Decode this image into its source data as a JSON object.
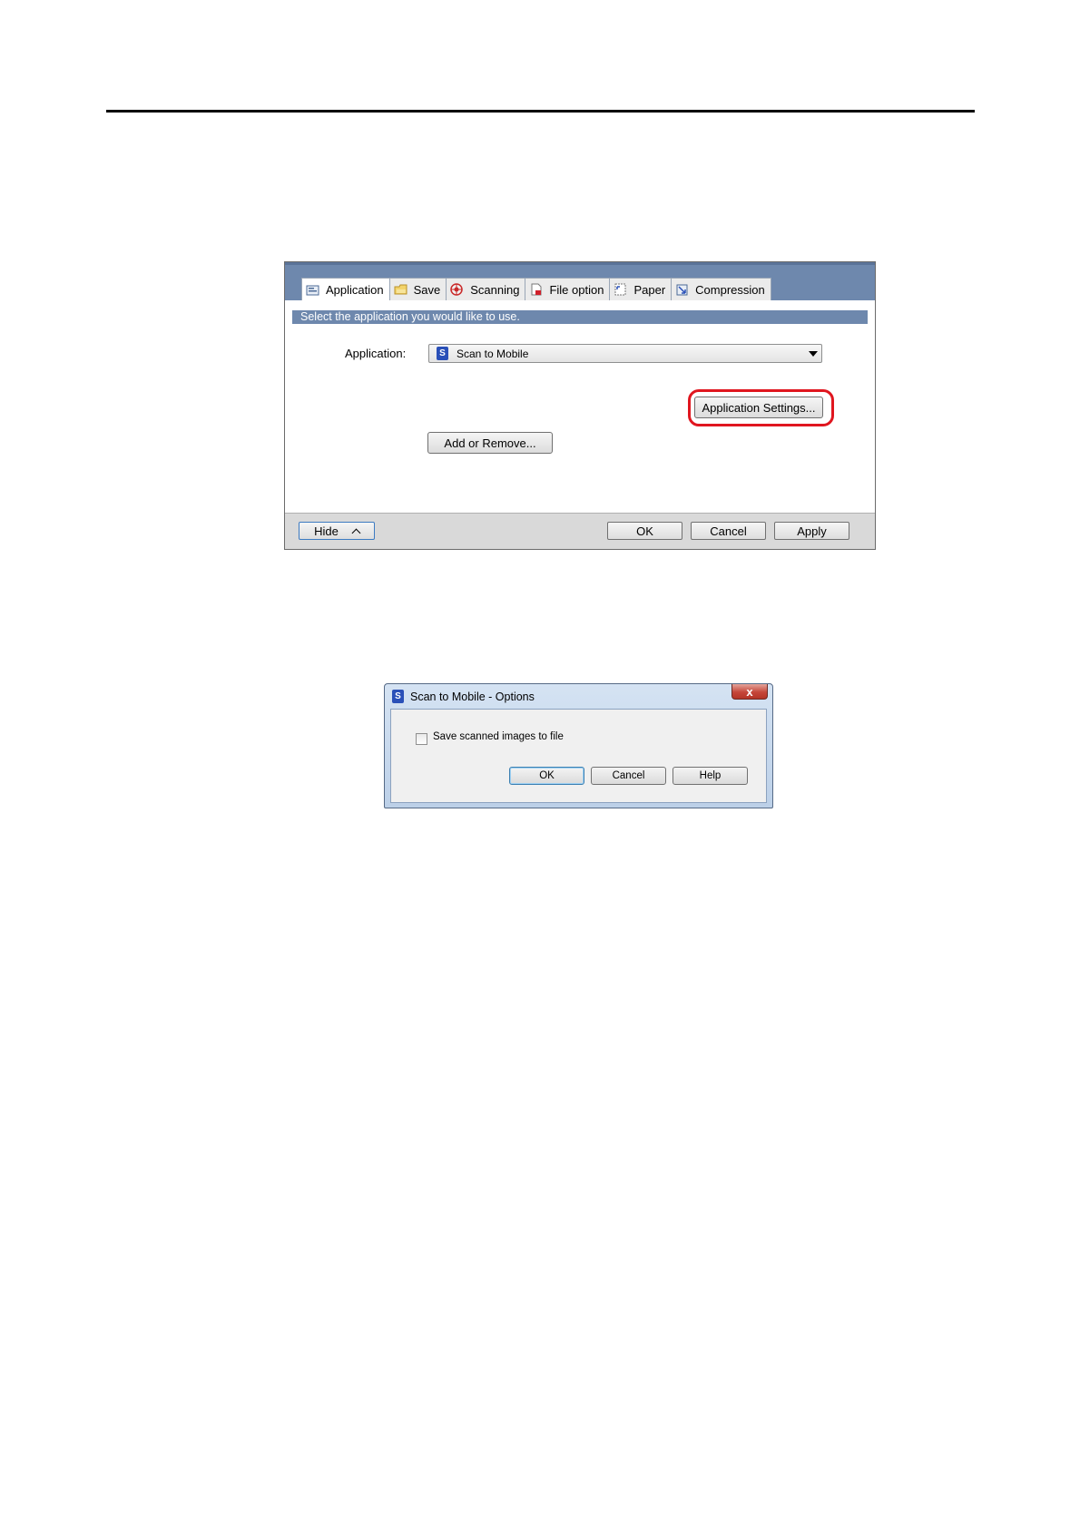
{
  "main_window": {
    "tabs": [
      {
        "label": "Application",
        "icon": "application-tab-icon"
      },
      {
        "label": "Save",
        "icon": "folder-icon"
      },
      {
        "label": "Scanning",
        "icon": "scanning-icon"
      },
      {
        "label": "File option",
        "icon": "file-option-icon"
      },
      {
        "label": "Paper",
        "icon": "paper-icon"
      },
      {
        "label": "Compression",
        "icon": "compression-icon"
      }
    ],
    "banner": "Select the application you would like to use.",
    "application_label": "Application:",
    "application_value": "Scan to Mobile",
    "application_settings_button": "Application Settings...",
    "add_remove_button": "Add or Remove...",
    "footer": {
      "hide": "Hide",
      "ok": "OK",
      "cancel": "Cancel",
      "apply": "Apply"
    },
    "highlight_color": "#e0161f",
    "header_color": "#6e88ad"
  },
  "options_dialog": {
    "title": "Scan to Mobile - Options",
    "close_glyph": "x",
    "checkbox_label": "Save scanned images to file",
    "checkbox_checked": false,
    "buttons": {
      "ok": "OK",
      "cancel": "Cancel",
      "help": "Help"
    }
  }
}
